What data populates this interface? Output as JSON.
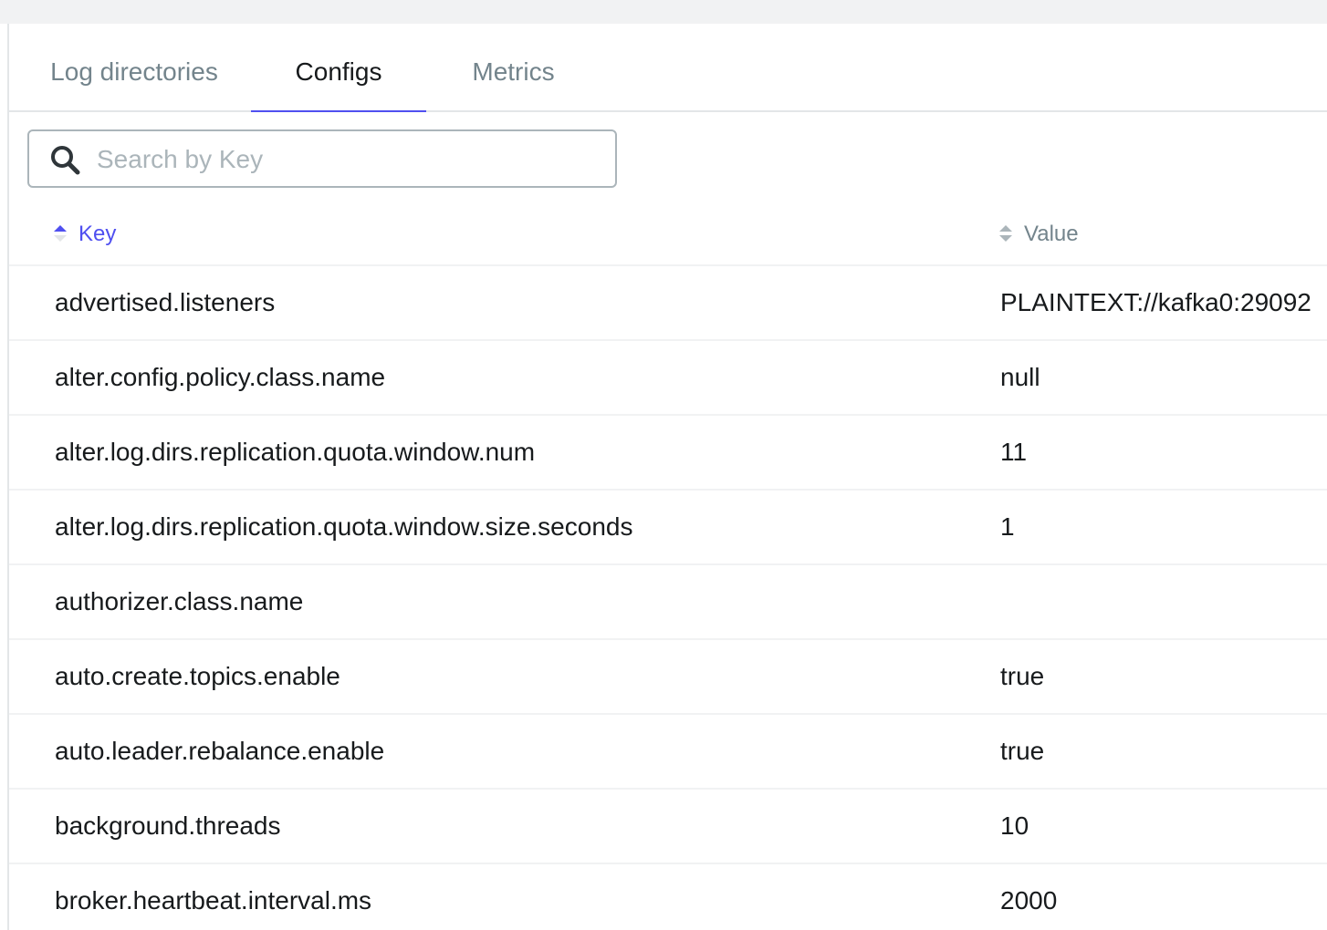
{
  "tabs": [
    {
      "label": "Log directories",
      "active": false
    },
    {
      "label": "Configs",
      "active": true
    },
    {
      "label": "Metrics",
      "active": false
    }
  ],
  "search": {
    "placeholder": "Search by Key",
    "value": ""
  },
  "table": {
    "columns": [
      {
        "label": "Key",
        "sorted": "asc"
      },
      {
        "label": "Value",
        "sorted": "none"
      }
    ],
    "rows": [
      {
        "key": "advertised.listeners",
        "value": "PLAINTEXT://kafka0:29092"
      },
      {
        "key": "alter.config.policy.class.name",
        "value": "null"
      },
      {
        "key": "alter.log.dirs.replication.quota.window.num",
        "value": "11"
      },
      {
        "key": "alter.log.dirs.replication.quota.window.size.seconds",
        "value": "1"
      },
      {
        "key": "authorizer.class.name",
        "value": ""
      },
      {
        "key": "auto.create.topics.enable",
        "value": "true"
      },
      {
        "key": "auto.leader.rebalance.enable",
        "value": "true"
      },
      {
        "key": "background.threads",
        "value": "10"
      },
      {
        "key": "broker.heartbeat.interval.ms",
        "value": "2000"
      }
    ]
  },
  "colors": {
    "accent": "#4f4ff0",
    "text": "#171a1c",
    "muted": "#73848c",
    "border": "#abb5ba"
  }
}
